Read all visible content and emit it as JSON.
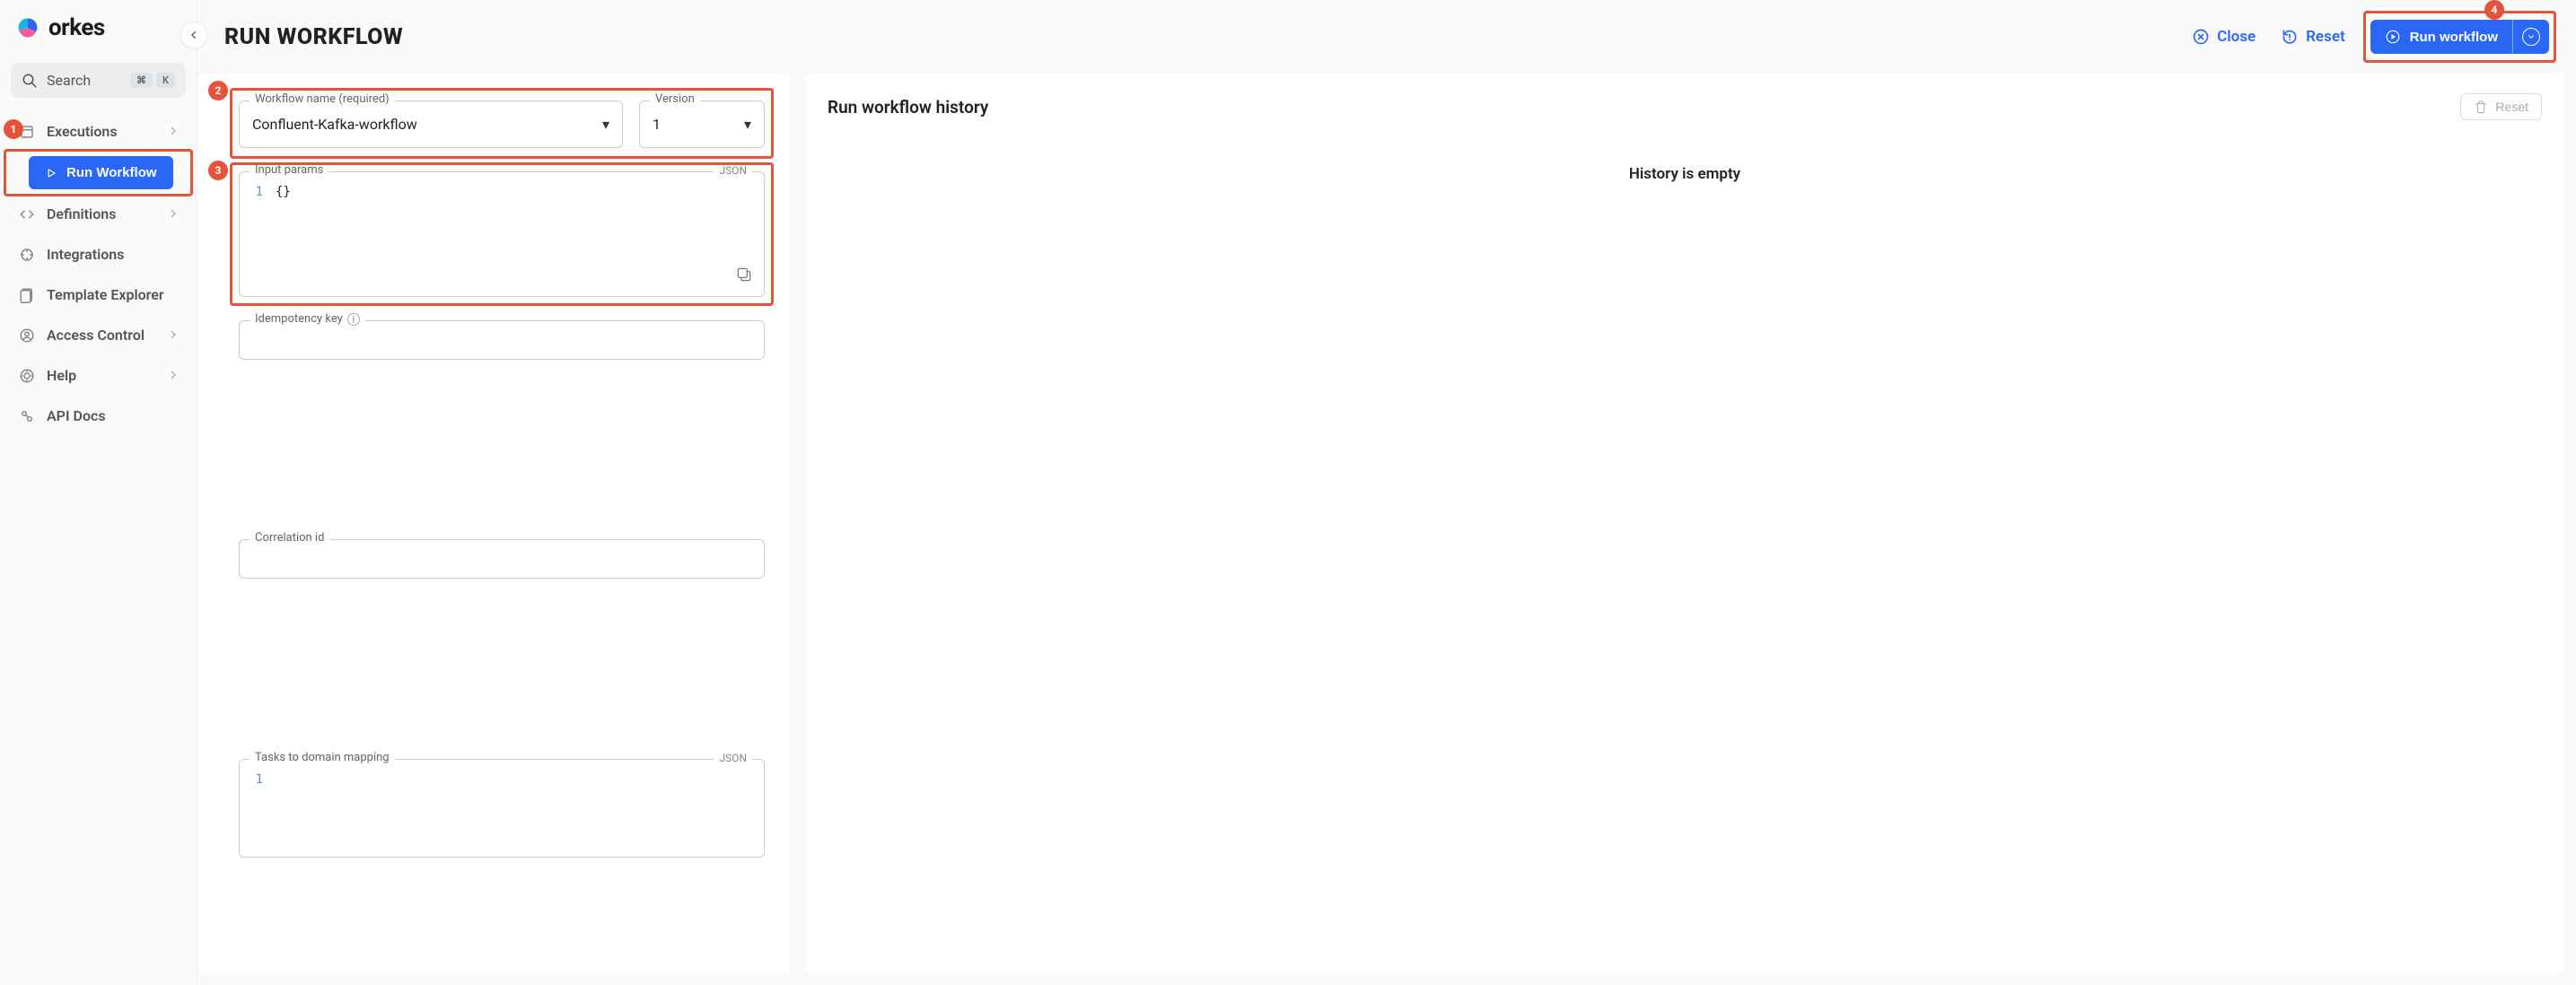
{
  "brand": "orkes",
  "search": {
    "placeholder": "Search",
    "kbd1": "⌘",
    "kbd2": "K"
  },
  "sidebar": {
    "executions": "Executions",
    "run_workflow": "Run Workflow",
    "definitions": "Definitions",
    "integrations": "Integrations",
    "template_explorer": "Template Explorer",
    "access_control": "Access Control",
    "help": "Help",
    "api_docs": "API Docs"
  },
  "page": {
    "title": "RUN WORKFLOW"
  },
  "header_actions": {
    "close": "Close",
    "reset": "Reset",
    "run_workflow": "Run workflow"
  },
  "form": {
    "workflow_name_label": "Workflow name (required)",
    "workflow_name_value": "Confluent-Kafka-workflow",
    "version_label": "Version",
    "version_value": "1",
    "input_params_label": "Input params",
    "input_params_tag": "JSON",
    "input_params_lineno": "1",
    "input_params_code": "{}",
    "idempotency_label": "Idempotency key",
    "correlation_label": "Correlation id",
    "tasks_domain_label": "Tasks to domain mapping",
    "tasks_domain_tag": "JSON",
    "tasks_domain_lineno": "1"
  },
  "history": {
    "title": "Run workflow history",
    "reset": "Reset",
    "empty": "History is empty"
  },
  "callouts": {
    "c1": "1",
    "c2": "2",
    "c3": "3",
    "c4": "4"
  }
}
